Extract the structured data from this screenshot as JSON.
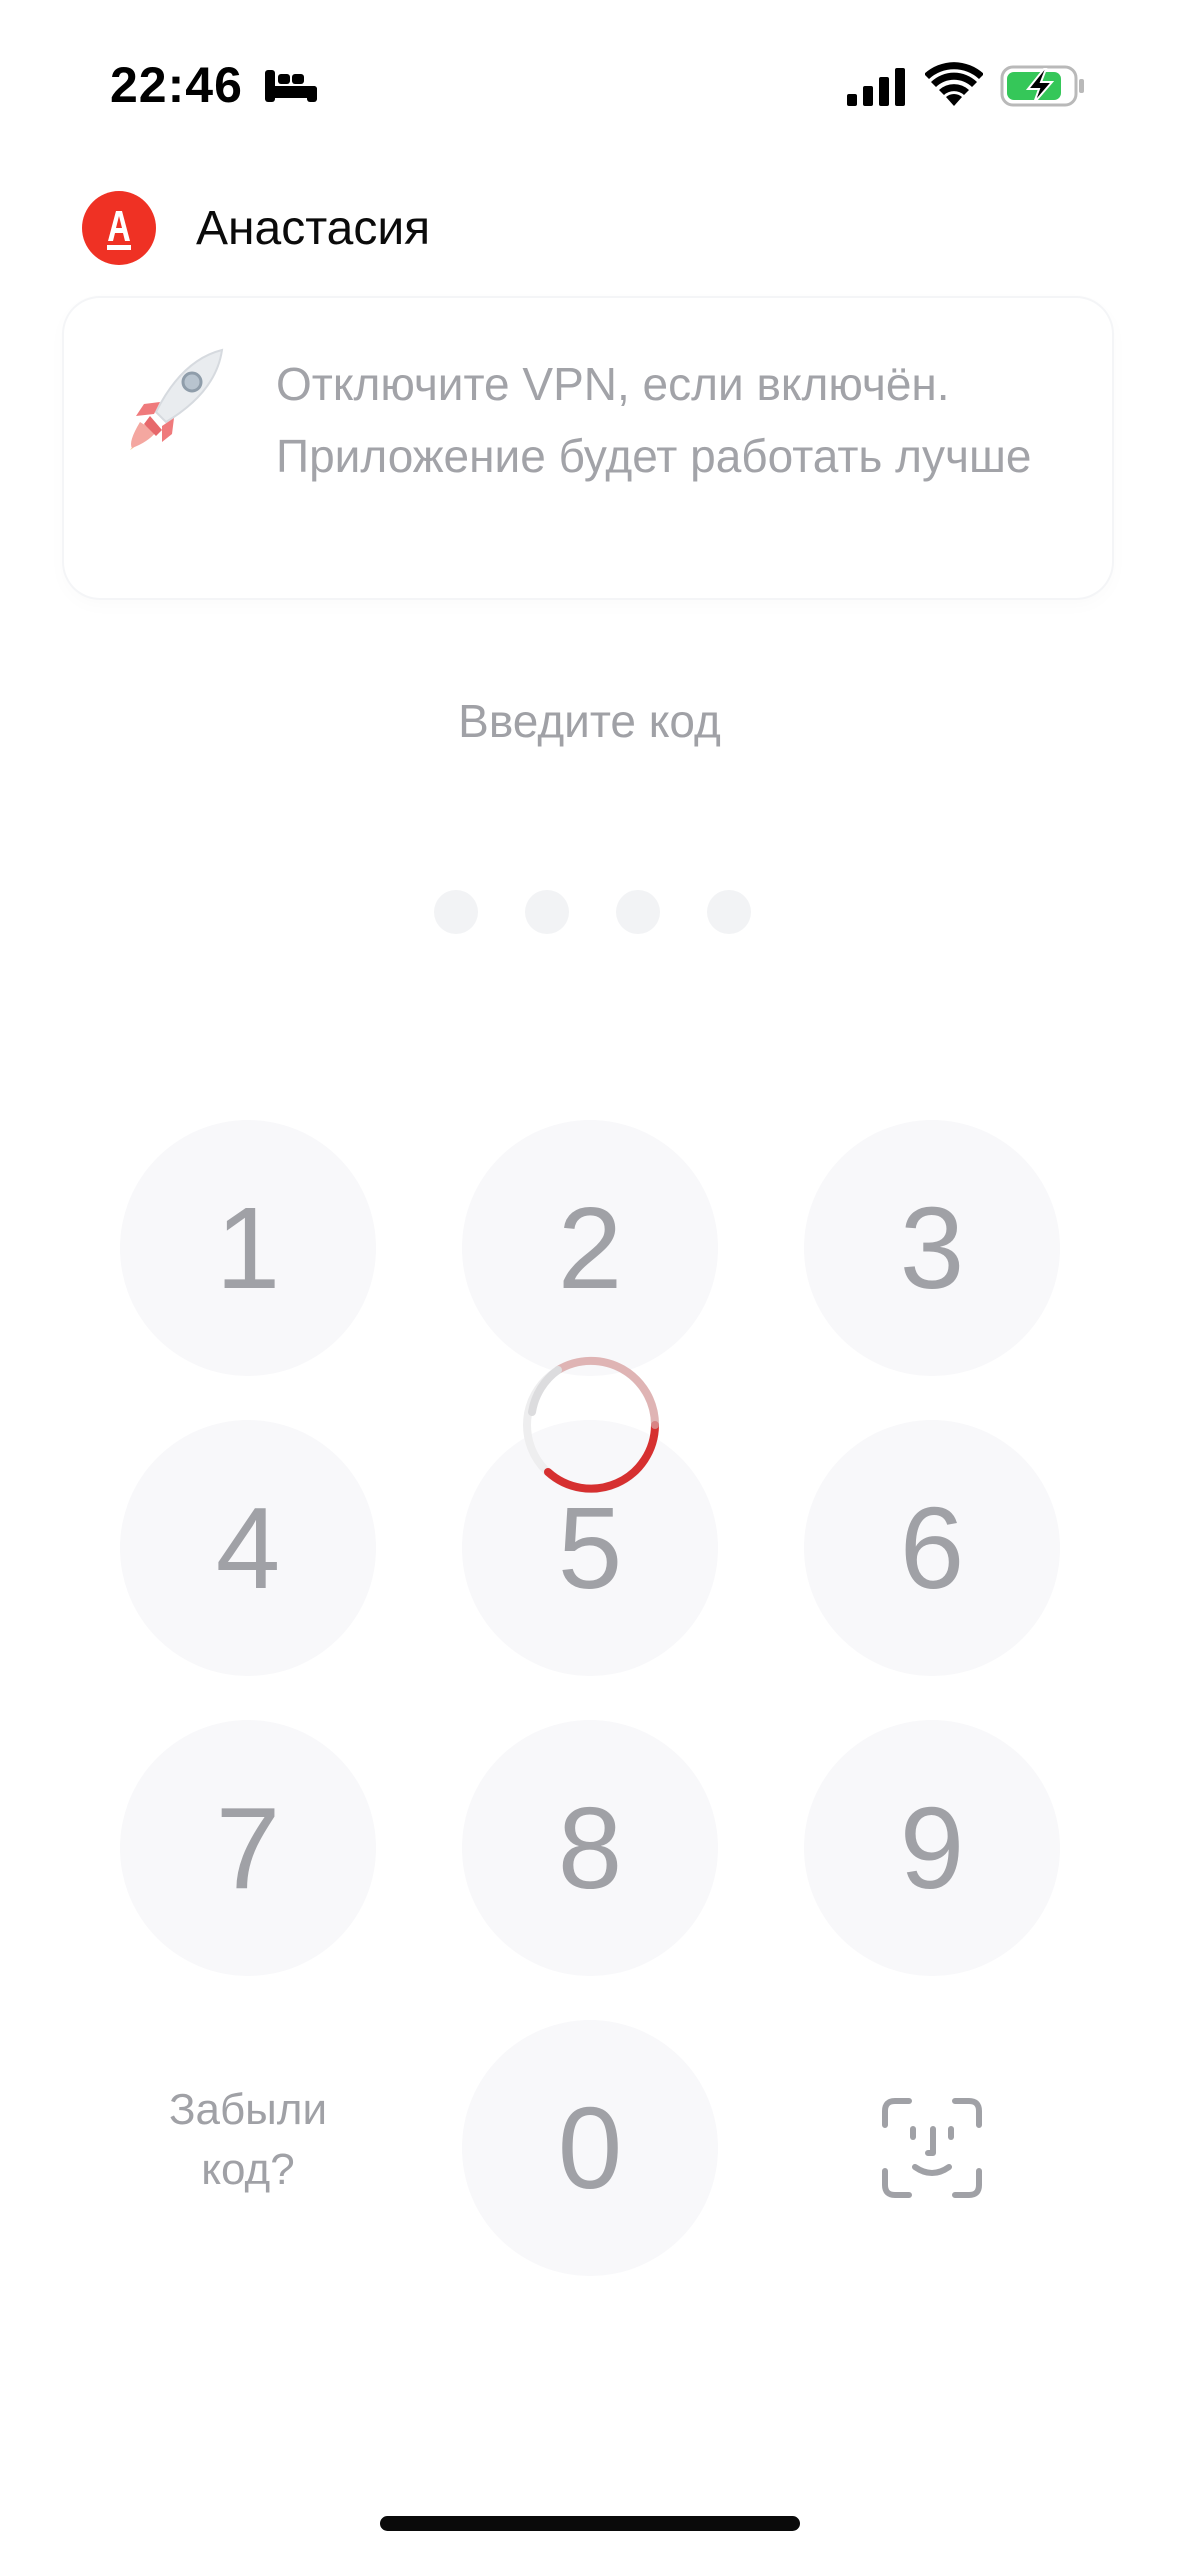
{
  "status_bar": {
    "time": "22:46",
    "icons": [
      "sleep-focus-icon",
      "cellular-signal-icon",
      "wifi-icon",
      "battery-charging-icon"
    ]
  },
  "header": {
    "logo_icon": "alfa-bank-logo",
    "logo_color": "#ef3124",
    "user_name": "Анастасия"
  },
  "vpn_banner": {
    "icon": "rocket-icon",
    "text": "Отключите VPN, если включён. Приложение будет работать лучше"
  },
  "pin": {
    "prompt": "Введите код",
    "length": 4,
    "entered": 0
  },
  "keypad": {
    "keys": [
      "1",
      "2",
      "3",
      "4",
      "5",
      "6",
      "7",
      "8",
      "9",
      "0"
    ],
    "forgot_line1": "Забыли",
    "forgot_line2": "код?",
    "biometric_icon": "face-id-icon"
  },
  "loading": {
    "icon": "loading-spinner",
    "accent_color": "#d63030"
  }
}
